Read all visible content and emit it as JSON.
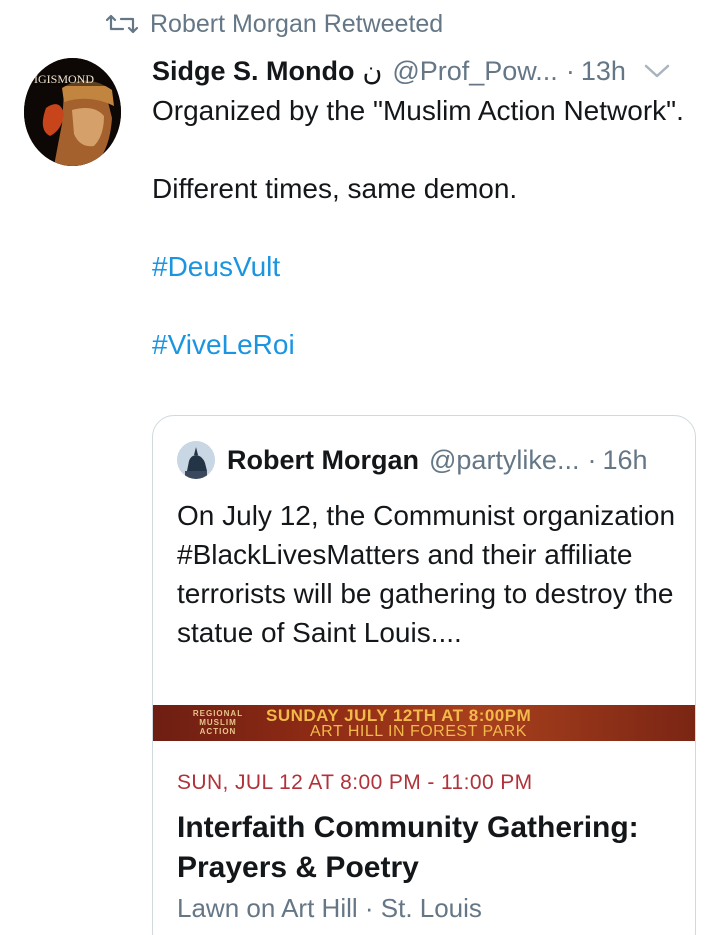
{
  "retweet": {
    "label": "Robert Morgan Retweeted",
    "icon": "retweet-icon"
  },
  "tweet": {
    "author_name": "Sidge S. Mondo",
    "author_suffix": "ن",
    "handle": "@Prof_Pow...",
    "separator": "·",
    "time": "13h",
    "avatar_text": "IGISMOND",
    "paragraphs": [
      "Organized by the \"Muslim Action Network\".",
      "Different times, same demon."
    ],
    "hashtags": [
      "#DeusVult",
      "#ViveLeRoi"
    ]
  },
  "quote": {
    "author_name": "Robert Morgan",
    "handle": "@partylike...",
    "separator": "·",
    "time": "16h",
    "text": "On July 12, the Communist organization #BlackLivesMatters and their affiliate terrorists will be gathering to destroy the statue of Saint Louis....",
    "banner": {
      "left_text": "REGIONAL MUSLIM ACTION",
      "line1": "SUNDAY JULY 12TH AT 8:00PM",
      "line2": "ART HILL IN FOREST PARK"
    },
    "event": {
      "time": "SUN, JUL 12 AT 8:00 PM - 11:00 PM",
      "title": "Interfaith Community Gathering: Prayers & Poetry",
      "location": "Lawn on Art Hill · St. Louis"
    }
  },
  "colors": {
    "link": "#1b95e0",
    "secondary_text": "#657786",
    "event_time": "#b0323a",
    "border": "#cfd9de"
  }
}
